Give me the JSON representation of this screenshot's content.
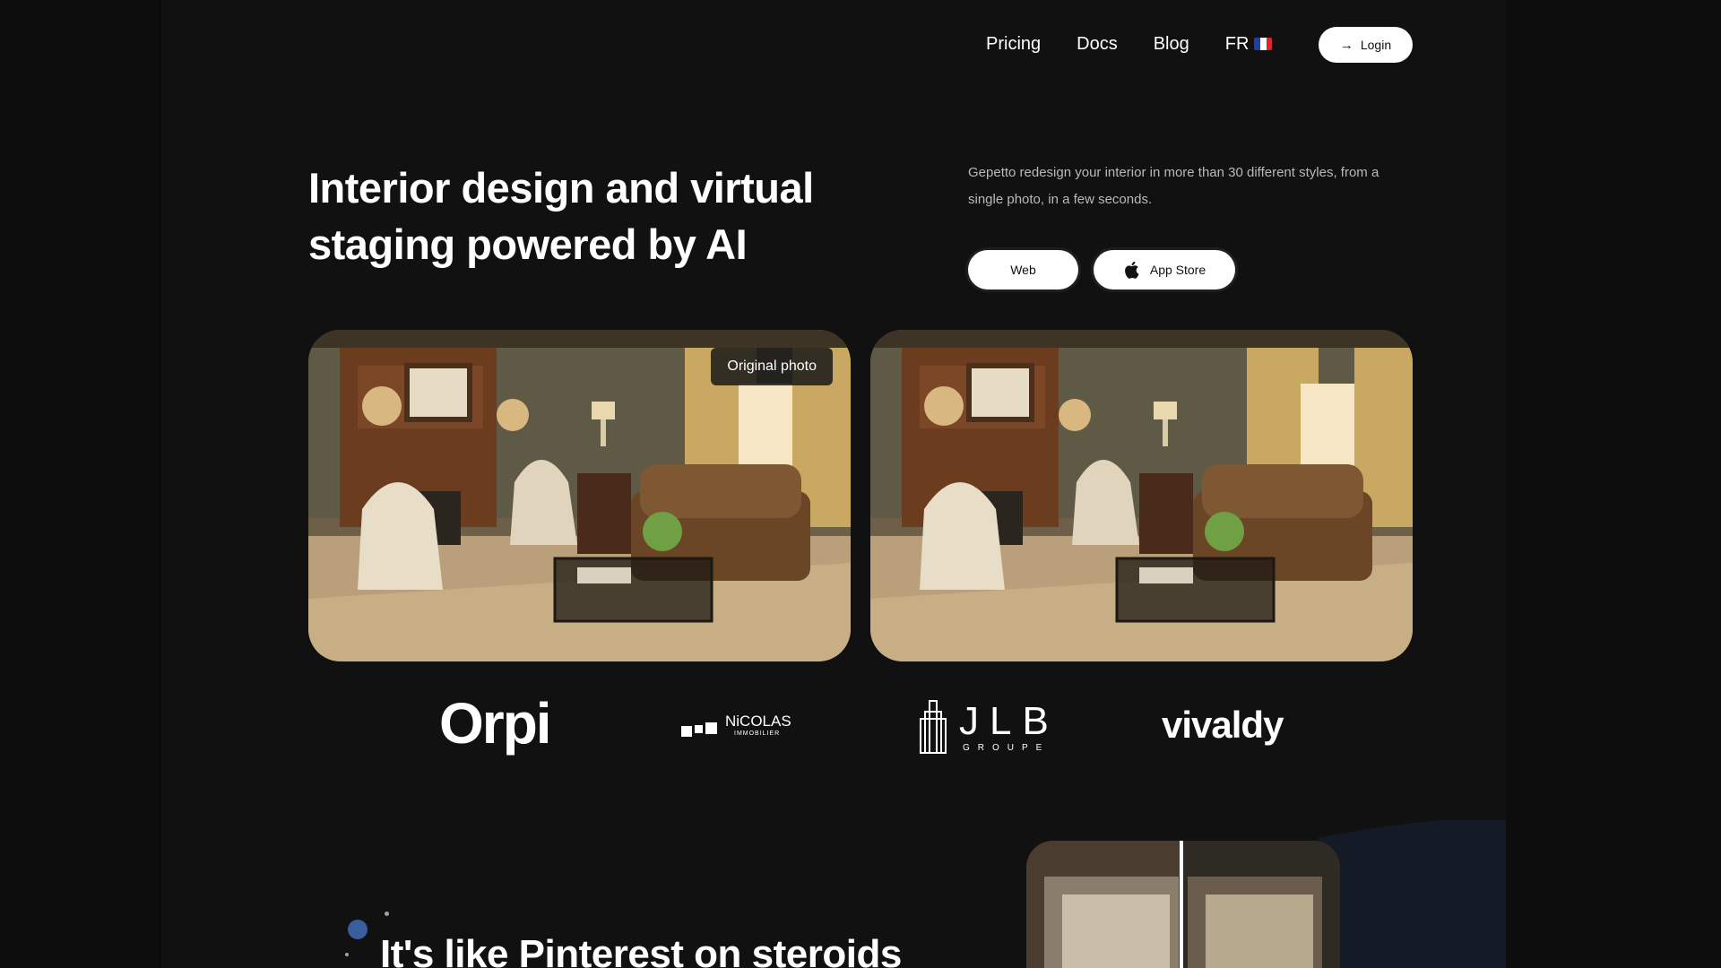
{
  "nav": {
    "links": [
      "Pricing",
      "Docs",
      "Blog"
    ],
    "language": "FR",
    "login_label": "Login"
  },
  "hero": {
    "title": "Interior design and virtual staging powered by AI",
    "description": "Gepetto redesign your interior in more than 30 different styles, from a single photo, in a few seconds.",
    "cta_web": "Web",
    "cta_appstore": "App Store"
  },
  "photos": {
    "original_badge": "Original photo"
  },
  "logos": {
    "orpi": "Orpi",
    "nicolas": "NiCOLAS",
    "nicolas_sub": "IMMOBILIER",
    "jlb": "JLB",
    "jlb_sub": "GROUPE",
    "vivaldy": "vivaldy"
  },
  "section2": {
    "title": "It's like Pinterest on steroids"
  },
  "colors": {
    "background": "#111112",
    "accent_blue": "#3a5d9e",
    "button_bg": "#ffffff"
  },
  "icons": [
    "arrow-right-icon",
    "apple-icon",
    "france-flag-icon"
  ]
}
